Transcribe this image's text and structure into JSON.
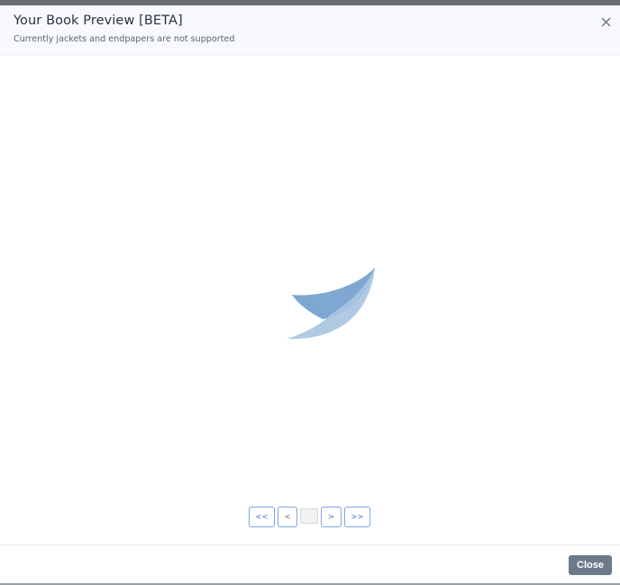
{
  "modal": {
    "title": "Your Book Preview [BETA]",
    "subtitle": "Currently jackets and endpapers are not supported",
    "close_icon": "close-icon"
  },
  "loader": {
    "icon": "loading-spinner-icon",
    "colors": [
      "#7ea7d2",
      "#a9c5e2"
    ]
  },
  "pager": {
    "first_label": "<<",
    "prev_label": "<",
    "page_value": "",
    "next_label": ">",
    "last_label": ">>"
  },
  "footer": {
    "close_label": "Close"
  },
  "colors": {
    "header_bg": "#f7f9fd",
    "pager_border": "#7ea5dd",
    "close_button_bg": "#6c7a8a"
  }
}
